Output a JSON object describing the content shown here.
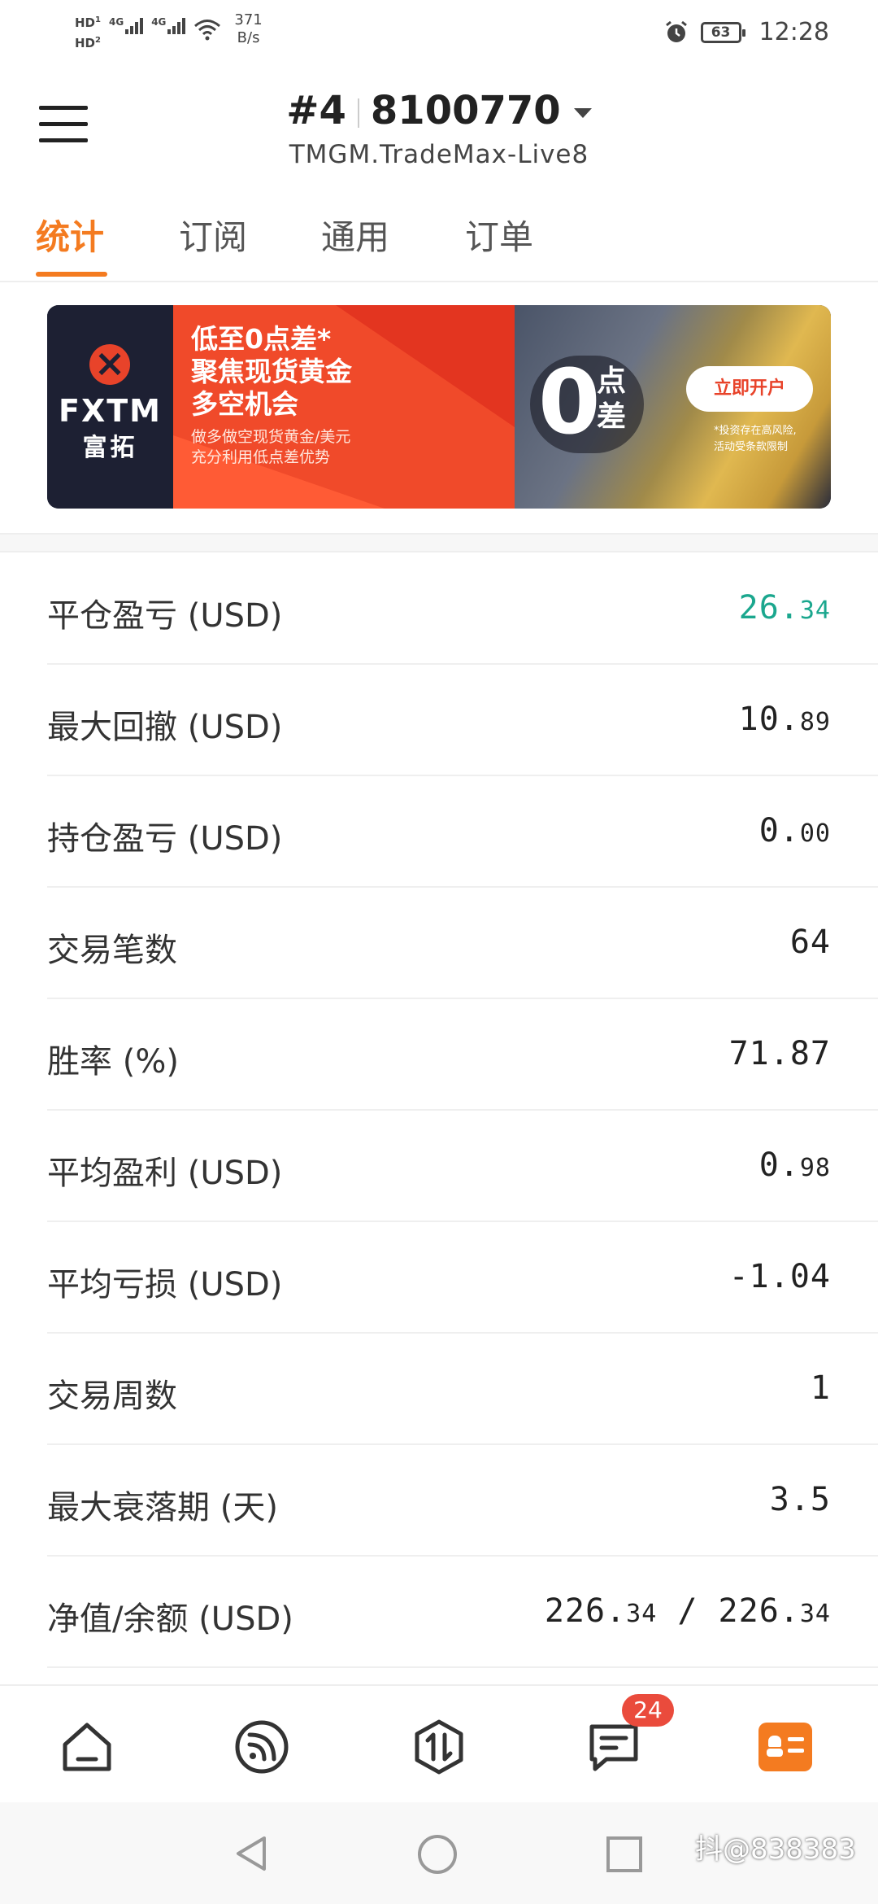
{
  "status_bar": {
    "hd1": "HD",
    "hd1_num": "1",
    "hd2": "HD",
    "hd2_num": "2",
    "net1": "4G",
    "net2": "4G",
    "speed_value": "371",
    "speed_unit": "B/s",
    "battery": "63",
    "time": "12:28"
  },
  "header": {
    "account_number": "#4",
    "account_id": "8100770",
    "server": "TMGM.TradeMax-Live8"
  },
  "tabs": [
    {
      "label": "统计",
      "active": true
    },
    {
      "label": "订阅",
      "active": false
    },
    {
      "label": "通用",
      "active": false
    },
    {
      "label": "订单",
      "active": false
    }
  ],
  "banner": {
    "brand": "FXTM",
    "brand_cn": "富拓",
    "headline_1": "低至0点差*",
    "headline_2": "聚焦现货黄金",
    "headline_3": "多空机会",
    "sub_1": "做多做空现货黄金/美元",
    "sub_2": "充分利用低点差优势",
    "zero": "0",
    "zero_label_1": "点",
    "zero_label_2": "差",
    "cta": "立即开户",
    "note_1": "*投资存在高风险,",
    "note_2": "活动受条款限制"
  },
  "stats": [
    {
      "label": "平仓盈亏 (USD)",
      "value_main": "26.",
      "value_small": "34",
      "color": "#1ba78e"
    },
    {
      "label": "最大回撤 (USD)",
      "value_main": "10.",
      "value_small": "89"
    },
    {
      "label": "持仓盈亏 (USD)",
      "value_main": "0.",
      "value_small": "00"
    },
    {
      "label": "交易笔数",
      "value_main": "64",
      "value_small": ""
    },
    {
      "label": "胜率 (%)",
      "value_main": "71.87",
      "value_small": ""
    },
    {
      "label": "平均盈利 (USD)",
      "value_main": "0.",
      "value_small": "98"
    },
    {
      "label": "平均亏损 (USD)",
      "value_main": "-1.04",
      "value_small": ""
    },
    {
      "label": "交易周数",
      "value_main": "1",
      "value_small": ""
    },
    {
      "label": "最大衰落期 (天)",
      "value_main": "3.5",
      "value_small": ""
    },
    {
      "label": "净值/余额 (USD)",
      "value_main": "226.",
      "value_small": "34",
      "value_main2": " / 226.",
      "value_small2": "34"
    }
  ],
  "bottom_nav": {
    "messages_badge": "24",
    "items": [
      "home-icon",
      "feed-icon",
      "trade-icon",
      "messages-icon",
      "profile-card-icon"
    ]
  },
  "watermark": "抖@838383"
}
